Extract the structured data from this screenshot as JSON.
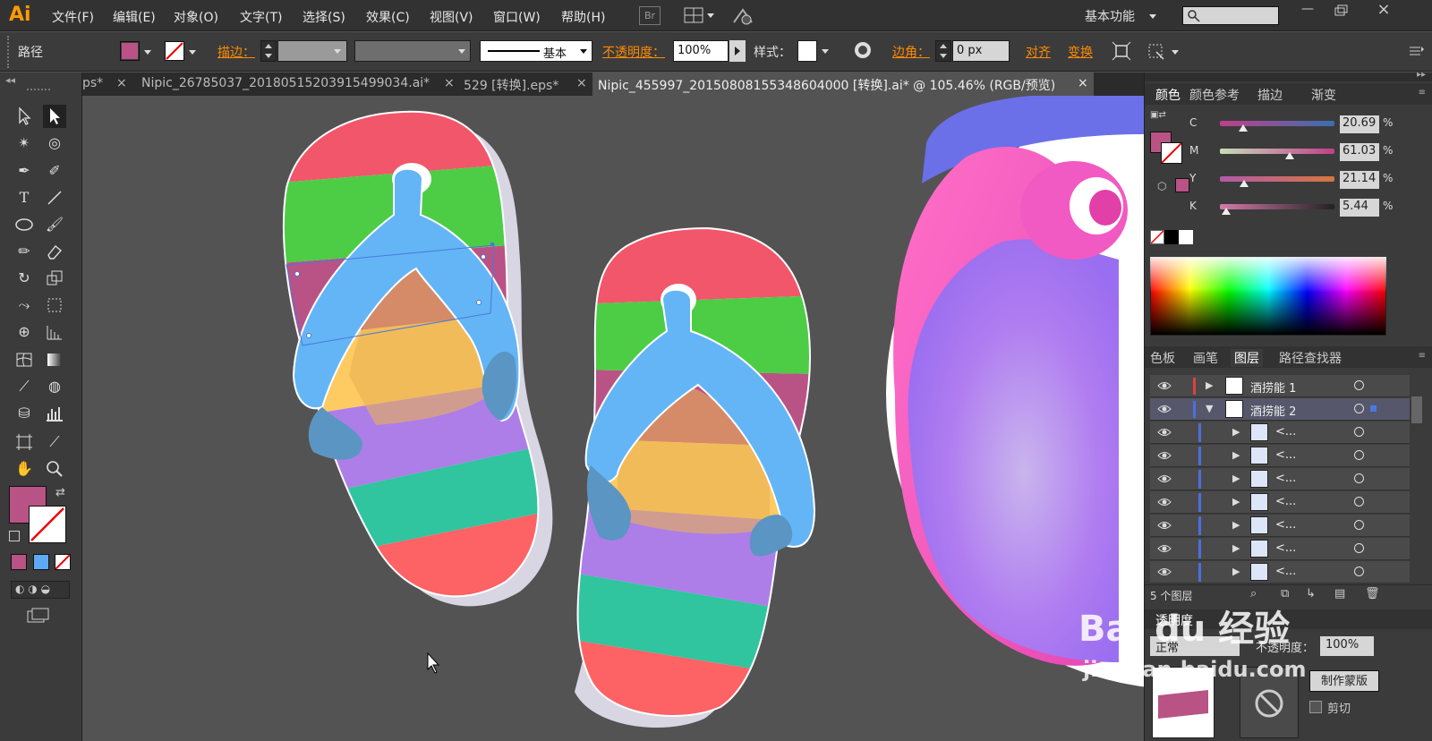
{
  "app": {
    "logo": "Ai"
  },
  "menu": [
    "文件(F)",
    "编辑(E)",
    "对象(O)",
    "文字(T)",
    "选择(S)",
    "效果(C)",
    "视图(V)",
    "窗口(W)",
    "帮助(H)"
  ],
  "bridge_label": "Br",
  "workspace": "基本功能",
  "control": {
    "object_type": "路径",
    "stroke_label": "描边：",
    "stroke_style": "基本",
    "opacity_label": "不透明度：",
    "opacity_value": "100%",
    "style_label": "样式：",
    "corner_label": "边角：",
    "corner_value": "0 px",
    "align_label": "对齐",
    "transform_label": "变换"
  },
  "tabs": [
    {
      "label": "ps*",
      "active": false
    },
    {
      "label": "Nipic_26785037_20180515203915499034.ai*",
      "active": false
    },
    {
      "label": "529 [转换].eps*",
      "active": false
    },
    {
      "label": "Nipic_455997_20150808155348604000 [转换].ai* @ 105.46% (RGB/预览)",
      "active": true
    }
  ],
  "close_glyph": "×",
  "color_panel": {
    "tabs": [
      "颜色",
      "颜色参考",
      "描边",
      "渐变"
    ],
    "channels": [
      {
        "label": "C",
        "value": "20.69",
        "pct": 20.69
      },
      {
        "label": "M",
        "value": "61.03",
        "pct": 61.03
      },
      {
        "label": "Y",
        "value": "21.14",
        "pct": 21.14
      },
      {
        "label": "K",
        "value": "5.44",
        "pct": 5.44
      }
    ],
    "percent": "%"
  },
  "layers_panel": {
    "tabs": [
      "色板",
      "画笔",
      "图层",
      "路径查找器"
    ],
    "layers": [
      {
        "name": "酒捞能 1",
        "expanded": false
      },
      {
        "name": "酒捞能 2",
        "expanded": true
      }
    ],
    "sublayers": [
      "<...",
      "<...",
      "<...",
      "<...",
      "<...",
      "<...",
      "<..."
    ],
    "count": "5 个图层"
  },
  "transparency_panel": {
    "title": "透明度",
    "mode": "正常",
    "opacity_label": "不透明度：",
    "opacity_value": "100%",
    "mask_button": "制作蒙版",
    "clip_label": "剪切"
  },
  "colors": {
    "fill": "#b95385",
    "accent": "#ff8a00",
    "sole_red": "#f2566a",
    "sole_green": "#4ccd45",
    "sole_yellow": "#fecb63",
    "sole_purple": "#ad7ee8",
    "sole_teal": "#30c49f",
    "strap": "#64b5f6"
  },
  "watermark": {
    "logo": "Bai du 经验",
    "url": "jingyan.baidu.com"
  }
}
